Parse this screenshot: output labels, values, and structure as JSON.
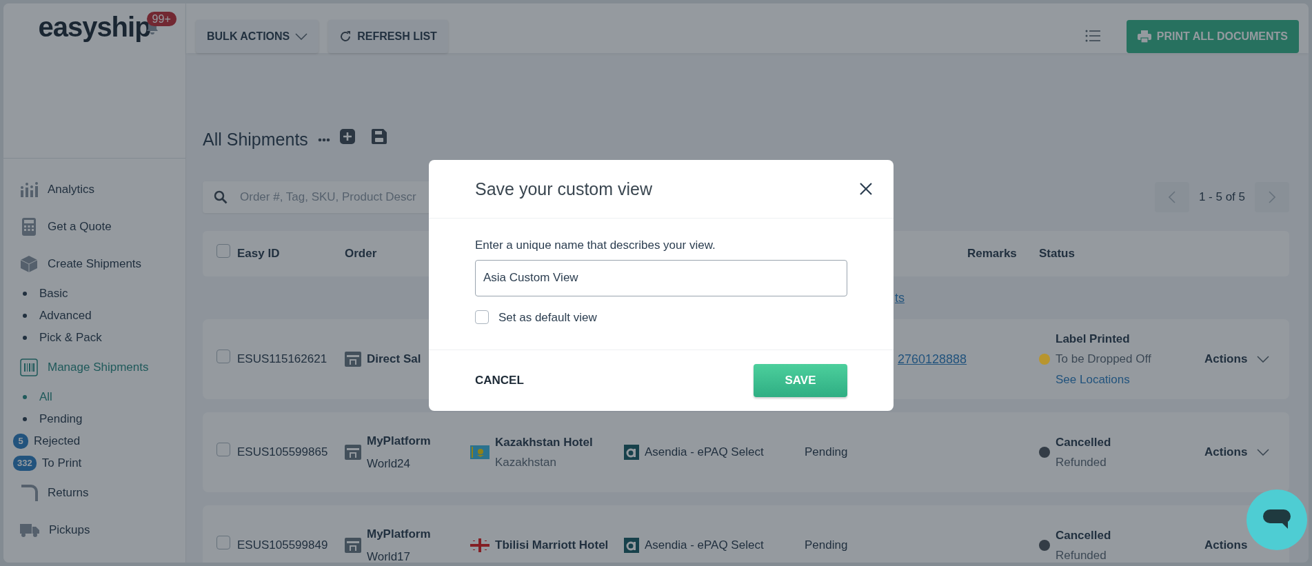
{
  "sidebar": {
    "logo": "easyship",
    "notification_count": "99+",
    "items": [
      {
        "label": "Analytics",
        "selected": false
      },
      {
        "label": "Get a Quote",
        "selected": false
      },
      {
        "label": "Create Shipments",
        "selected": false,
        "children": [
          {
            "label": "Basic",
            "selected": false
          },
          {
            "label": "Advanced",
            "selected": false
          },
          {
            "label": "Pick & Pack",
            "selected": false
          }
        ]
      },
      {
        "label": "Manage Shipments",
        "selected": true,
        "children": [
          {
            "label": "All",
            "selected": true
          },
          {
            "label": "Pending",
            "selected": false
          },
          {
            "label": "Rejected",
            "selected": false,
            "badge": "5"
          },
          {
            "label": "To Print",
            "selected": false,
            "badge": "332"
          }
        ]
      },
      {
        "label": "Returns",
        "selected": false
      },
      {
        "label": "Pickups",
        "selected": false
      }
    ]
  },
  "toolbar": {
    "bulk_actions": "BULK ACTIONS",
    "refresh": "REFRESH LIST",
    "print_all": "PRINT ALL DOCUMENTS"
  },
  "view": {
    "title": "All Shipments"
  },
  "search": {
    "placeholder": "Order #, Tag, SKU, Product Descr"
  },
  "pagination": {
    "range": "1 - 5 of 5"
  },
  "table": {
    "select_all_checked": false,
    "columns": [
      "Easy ID",
      "Order",
      "Remarks",
      "Status"
    ],
    "notice_link": "ts",
    "rows": [
      {
        "checked": false,
        "easy_id": "ESUS115162621",
        "order_name": "Direct Sal",
        "tracking": "2760128888",
        "status_title": "Label Printed",
        "status_detail": "To be Dropped Off",
        "status_link": "See Locations",
        "color": "#b8952e",
        "actions": "Actions"
      },
      {
        "checked": false,
        "easy_id": "ESUS105599865",
        "order_name": "MyPlatform",
        "order_store": "World24",
        "flag": {
          "kind": "kz"
        },
        "receiver": "Kazakhstan Hotel",
        "receiver_country": "Kazakhstan",
        "courier": "Asendia - ePAQ Select",
        "shipment_state": "Pending",
        "status_title": "Cancelled",
        "status_detail": "Refunded",
        "color": "#333c46",
        "actions": "Actions"
      },
      {
        "checked": false,
        "easy_id": "ESUS105599849",
        "order_name": "MyPlatform",
        "order_store": "World17",
        "flag": {
          "kind": "ge"
        },
        "receiver": "Tbilisi Marriott Hotel",
        "courier": "Asendia - ePAQ Select",
        "shipment_state": "Pending",
        "status_title": "Cancelled",
        "status_detail": "Refunded",
        "color": "#333c46",
        "actions": "Actions"
      }
    ]
  },
  "modal": {
    "title": "Save your custom view",
    "label": "Enter a unique name that describes your view.",
    "value": "Asia Custom View",
    "default_checkbox": {
      "label": "Set as default view",
      "checked": false
    },
    "cancel": "CANCEL",
    "save": "SAVE"
  }
}
